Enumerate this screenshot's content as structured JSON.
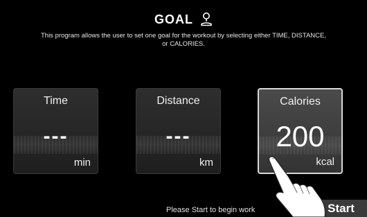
{
  "header": {
    "title": "GOAL",
    "icon": "location-pin-icon",
    "description": "This program allows the user to set one goal for the workout by selecting either TIME, DISTANCE, or CALORIES."
  },
  "cards": [
    {
      "label": "Time",
      "value": "---",
      "unit": "min",
      "selected": false
    },
    {
      "label": "Distance",
      "value": "---",
      "unit": "km",
      "selected": false
    },
    {
      "label": "Calories",
      "value": "200",
      "unit": "kcal",
      "selected": true
    }
  ],
  "footer": {
    "hint": "Please Start to begin work",
    "start_label": "Start"
  },
  "colors": {
    "background": "#000000",
    "card": "#262626",
    "card_selected": "#3d3d3d",
    "selected_border": "#d8d8d8",
    "start_button": "#3a3a3a"
  }
}
